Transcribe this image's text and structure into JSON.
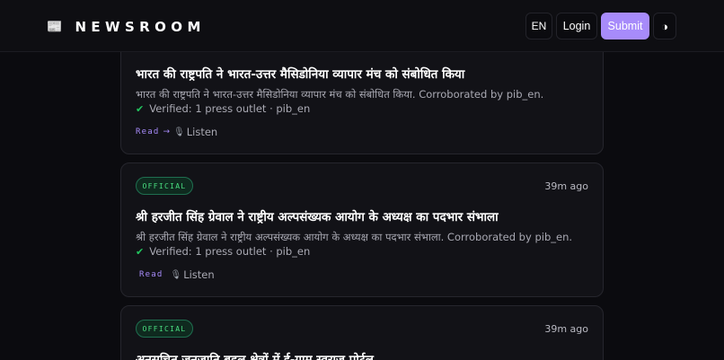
{
  "header": {
    "brand_icon": "newspaper-icon",
    "brand_glyph": "📰",
    "brand_name": "NEWSROOM",
    "lang_label": "EN",
    "login_label": "Login",
    "submit_label": "Submit",
    "theme_glyph": "◑",
    "accent_color": "#a78bfa"
  },
  "cards": [
    {
      "title": "भारत की राष्ट्रपति ने भारत-उत्तर मैसिडोनिया व्यापार मंच को संबोधित किया",
      "description": "भारत की राष्ट्रपति ने भारत-उत्तर मैसिडोनिया व्यापार मंच को संबोधित किया. Corroborated by pib_en.",
      "verified": "Verified: 1 press outlet · pib_en",
      "read_label": "Read",
      "read_arrow": "→",
      "listen_label": "Listen",
      "mic_glyph": "🎙"
    },
    {
      "badge": "OFFICIAL",
      "time": "39m ago",
      "title": "श्री हरजीत सिंह ग्रेवाल ने राष्ट्रीय अल्पसंख्यक आयोग के अध्यक्ष का पदभार संभाला",
      "description": "श्री हरजीत सिंह ग्रेवाल ने राष्ट्रीय अल्पसंख्यक आयोग के अध्यक्ष का पदभार संभाला. Corroborated by pib_en.",
      "verified": "Verified: 1 press outlet · pib_en",
      "read_label": "Read",
      "listen_label": "Listen",
      "mic_glyph": "🎙"
    },
    {
      "badge": "OFFICIAL",
      "time": "39m ago",
      "title": "अनुसूचित जनजाति बहुल क्षेत्रों में ई-ग्राम स्वराज पोर्टल"
    }
  ]
}
